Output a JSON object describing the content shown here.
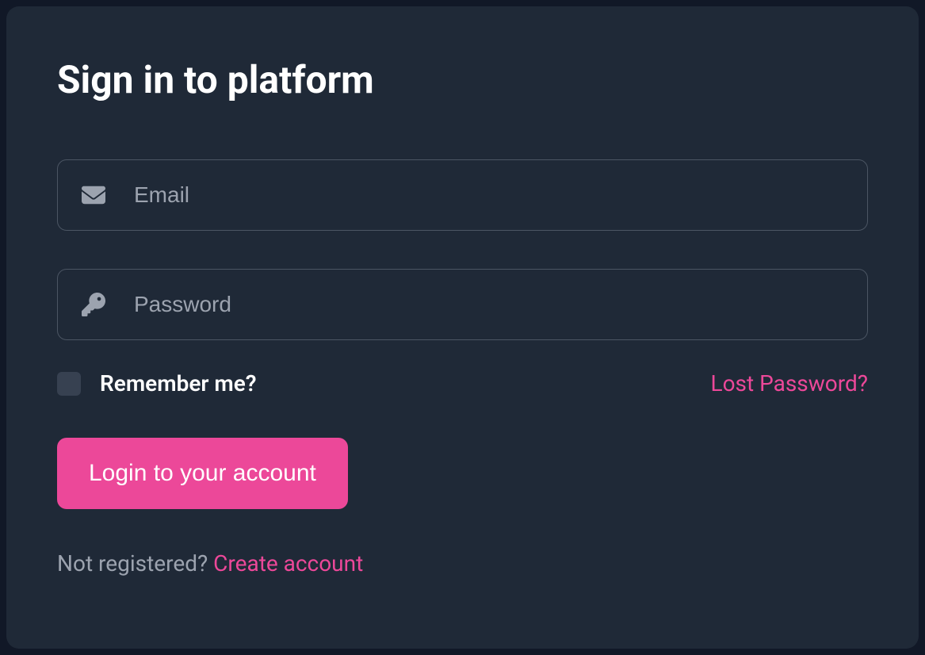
{
  "title": "Sign in to platform",
  "email": {
    "placeholder": "Email",
    "value": ""
  },
  "password": {
    "placeholder": "Password",
    "value": ""
  },
  "remember": {
    "label": "Remember me?",
    "checked": false
  },
  "lost_password": "Lost Password?",
  "login_button": "Login to your account",
  "footer": {
    "prefix": "Not registered? ",
    "link": "Create account"
  },
  "colors": {
    "accent": "#ec4899",
    "card_bg": "#1f2937",
    "page_bg": "#111827",
    "border": "#4b5563",
    "muted_text": "#9ca3af"
  }
}
